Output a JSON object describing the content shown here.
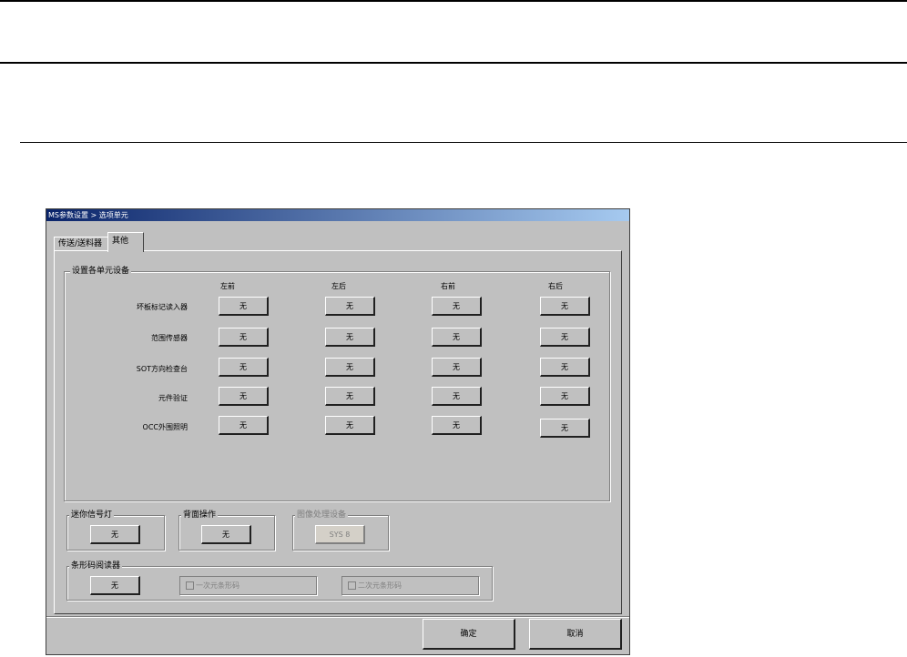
{
  "window": {
    "title": "MS参数设置 > 选项单元",
    "tabs": [
      {
        "label": "传送/送料器"
      },
      {
        "label": "其他"
      }
    ]
  },
  "unit_settings": {
    "legend": "设置各单元设备",
    "columns": [
      "左前",
      "左后",
      "右前",
      "右后"
    ],
    "rows": [
      {
        "label": "坏板标记读入器",
        "values": [
          "无",
          "无",
          "无",
          "无"
        ]
      },
      {
        "label": "范围传感器",
        "values": [
          "无",
          "无",
          "无",
          "无"
        ]
      },
      {
        "label": "SOT方向检查台",
        "values": [
          "无",
          "无",
          "无",
          "无"
        ]
      },
      {
        "label": "元件验证",
        "values": [
          "无",
          "无",
          "无",
          "无"
        ]
      },
      {
        "label": "OCC外围照明",
        "values": [
          "无",
          "无",
          "无",
          "无"
        ]
      }
    ]
  },
  "mini_signal": {
    "legend": "迷你信号灯",
    "value": "无"
  },
  "rear_operation": {
    "legend": "背面操作",
    "value": "无"
  },
  "image_processing": {
    "legend": "图像处理设备",
    "value": "SYS 8"
  },
  "barcode": {
    "legend": "条形码阅读器",
    "value": "无",
    "option_1d": "一次元条形码",
    "option_2d": "二次元条形码"
  },
  "footer": {
    "ok_label": "确定",
    "cancel_label": "取消"
  }
}
